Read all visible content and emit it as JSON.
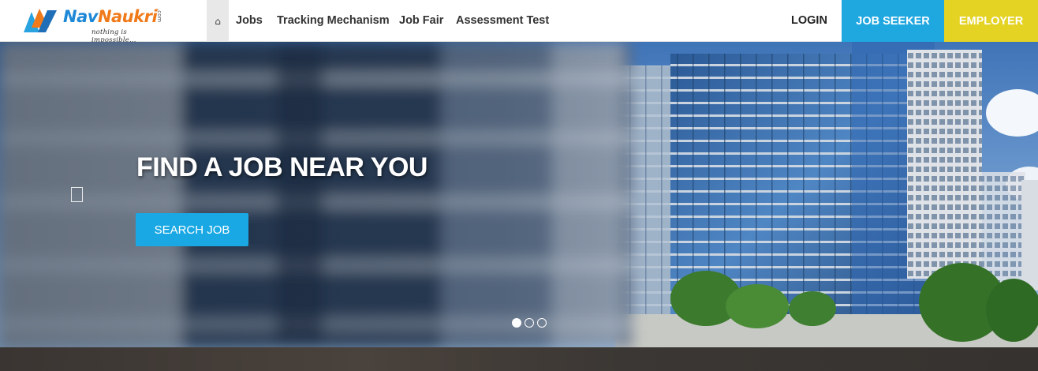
{
  "brand": {
    "name_part1": "Nav",
    "name_part2": "Naukri",
    "dotcom": ".com",
    "tagline": "nothing is impossible..."
  },
  "nav": {
    "home_icon": "home-icon",
    "links": [
      "Jobs",
      "Tracking Mechanism",
      "Job Fair",
      "Assessment Test"
    ],
    "login": "LOGIN",
    "job_seeker": "JOB SEEKER",
    "employer": "EMPLOYER"
  },
  "hero": {
    "title": "FIND A JOB NEAR YOU",
    "cta": "SEARCH JOB",
    "slides": 3,
    "active_slide": 1
  },
  "colors": {
    "accent_blue": "#1fa7e0",
    "employer_yellow": "#e4d323",
    "brand_orange": "#f07a1a",
    "brand_blue": "#1e88d6"
  }
}
